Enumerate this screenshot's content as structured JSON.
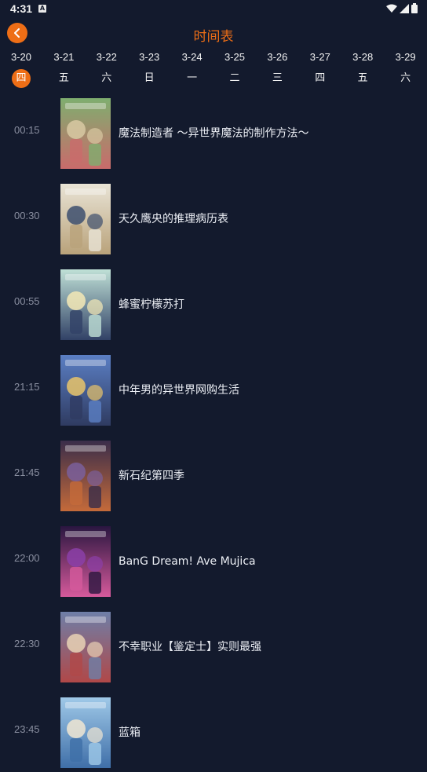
{
  "status": {
    "time": "4:31"
  },
  "header": {
    "title": "时间表"
  },
  "dates": [
    {
      "date": "3-20",
      "weekday": "四",
      "active": true
    },
    {
      "date": "3-21",
      "weekday": "五"
    },
    {
      "date": "3-22",
      "weekday": "六"
    },
    {
      "date": "3-23",
      "weekday": "日"
    },
    {
      "date": "3-24",
      "weekday": "一"
    },
    {
      "date": "3-25",
      "weekday": "二"
    },
    {
      "date": "3-26",
      "weekday": "三"
    },
    {
      "date": "3-27",
      "weekday": "四"
    },
    {
      "date": "3-28",
      "weekday": "五"
    },
    {
      "date": "3-29",
      "weekday": "六"
    }
  ],
  "schedule": [
    {
      "time": "00:15",
      "title": "魔法制造者 ～异世界魔法的制作方法～",
      "colors": [
        "#7fae6f",
        "#d8c9a3",
        "#c96b6b"
      ]
    },
    {
      "time": "00:30",
      "title": "天久鹰央的推理病历表",
      "colors": [
        "#e9e4d6",
        "#3d4f6e",
        "#b9a27a"
      ]
    },
    {
      "time": "00:55",
      "title": "蜂蜜柠檬苏打",
      "colors": [
        "#bfe0d6",
        "#f5e9b6",
        "#314166"
      ]
    },
    {
      "time": "21:15",
      "title": "中年男的异世界网购生活",
      "colors": [
        "#5b7fc4",
        "#e9c46a",
        "#2f3b61"
      ]
    },
    {
      "time": "21:45",
      "title": "新石纪第四季",
      "colors": [
        "#3a2d4a",
        "#7a5f9b",
        "#c46a3a"
      ]
    },
    {
      "time": "22:00",
      "title": "BanG Dream! Ave Mujica",
      "colors": [
        "#2a1640",
        "#8b3fa8",
        "#d65a9c"
      ]
    },
    {
      "time": "22:30",
      "title": "不幸职业【鉴定士】实则最强",
      "colors": [
        "#6e7fa8",
        "#e9d2b5",
        "#b04848"
      ]
    },
    {
      "time": "23:45",
      "title": "蓝箱",
      "colors": [
        "#9fc9e8",
        "#f0e6d2",
        "#3f6fa8"
      ]
    }
  ]
}
